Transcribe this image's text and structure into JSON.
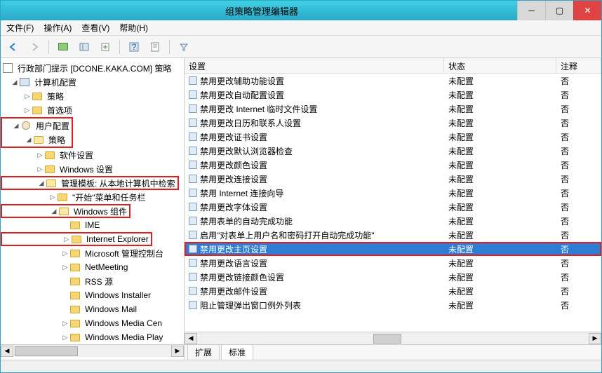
{
  "window": {
    "title": "组策略管理编辑器"
  },
  "menu": {
    "file": "文件(F)",
    "action": "操作(A)",
    "view": "查看(V)",
    "help": "帮助(H)"
  },
  "tree": {
    "root": "行政部门提示 [DCONE.KAKA.COM] 策略",
    "computer_config": "计算机配置",
    "policies": "策略",
    "preferences": "首选项",
    "user_config": "用户配置",
    "software_settings": "软件设置",
    "windows_settings": "Windows 设置",
    "admin_templates": "管理模板: 从本地计算机中检索",
    "start_taskbar": "\"开始\"菜单和任务栏",
    "windows_components": "Windows 组件",
    "ime": "IME",
    "ie": "Internet Explorer",
    "mmc": "Microsoft 管理控制台",
    "netmeeting": "NetMeeting",
    "rss": "RSS 源",
    "win_installer": "Windows Installer",
    "win_mail": "Windows Mail",
    "win_media_cen": "Windows Media Cen",
    "win_media_play": "Windows Media Play"
  },
  "columns": {
    "setting": "设置",
    "state": "状态",
    "comment": "注释"
  },
  "settings": [
    {
      "name": "禁用更改辅助功能设置",
      "state": "未配置",
      "comment": "否"
    },
    {
      "name": "禁用更改自动配置设置",
      "state": "未配置",
      "comment": "否"
    },
    {
      "name": "禁用更改 Internet 临时文件设置",
      "state": "未配置",
      "comment": "否"
    },
    {
      "name": "禁用更改日历和联系人设置",
      "state": "未配置",
      "comment": "否"
    },
    {
      "name": "禁用更改证书设置",
      "state": "未配置",
      "comment": "否"
    },
    {
      "name": "禁用更改默认浏览器检查",
      "state": "未配置",
      "comment": "否"
    },
    {
      "name": "禁用更改颜色设置",
      "state": "未配置",
      "comment": "否"
    },
    {
      "name": "禁用更改连接设置",
      "state": "未配置",
      "comment": "否"
    },
    {
      "name": "禁用 Internet 连接向导",
      "state": "未配置",
      "comment": "否"
    },
    {
      "name": "禁用更改字体设置",
      "state": "未配置",
      "comment": "否"
    },
    {
      "name": "禁用表单的自动完成功能",
      "state": "未配置",
      "comment": "否"
    },
    {
      "name": "启用\"对表单上用户名和密码打开自动完成功能\"",
      "state": "未配置",
      "comment": "否"
    },
    {
      "name": "禁用更改主页设置",
      "state": "未配置",
      "comment": "否",
      "selected": true,
      "highlight": true
    },
    {
      "name": "禁用更改语言设置",
      "state": "未配置",
      "comment": "否"
    },
    {
      "name": "禁用更改链接颜色设置",
      "state": "未配置",
      "comment": "否"
    },
    {
      "name": "禁用更改邮件设置",
      "state": "未配置",
      "comment": "否"
    },
    {
      "name": "阻止管理弹出窗口例外列表",
      "state": "未配置",
      "comment": "否"
    }
  ],
  "tabs": {
    "extended": "扩展",
    "standard": "标准"
  }
}
